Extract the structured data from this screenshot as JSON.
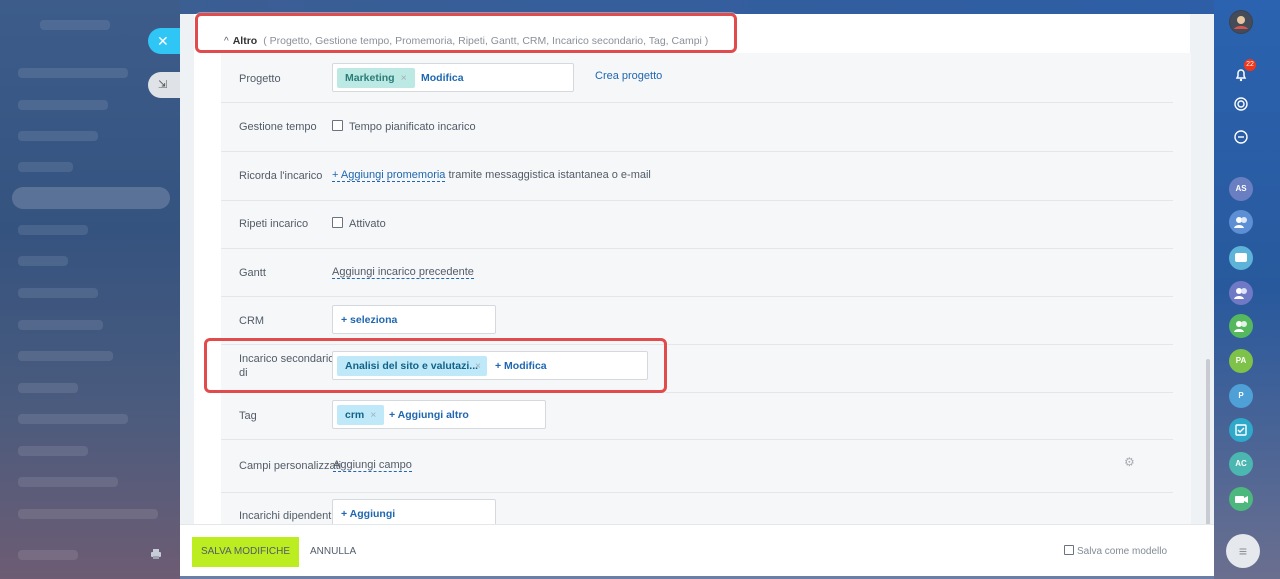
{
  "panel": {
    "close_icon": "✕",
    "collapse_icon": "⇲"
  },
  "altro": {
    "title": "Altro",
    "sections": "( Progetto,  Gestione tempo,  Promemoria,  Ripeti,  Gantt,  CRM,  Incarico secondario,  Tag,  Campi )"
  },
  "fields": {
    "progetto": {
      "label": "Progetto",
      "chip": "Marketing",
      "edit": "Modifica",
      "create": "Crea progetto"
    },
    "gestione_tempo": {
      "label": "Gestione tempo",
      "checkbox_label": "Tempo pianificato incarico"
    },
    "ricorda": {
      "label": "Ricorda l'incarico",
      "link": "+ Aggiungi promemoria",
      "suffix": " tramite messaggistica istantanea o e-mail"
    },
    "ripeti": {
      "label": "Ripeti incarico",
      "checkbox_label": "Attivato"
    },
    "gantt": {
      "label": "Gantt",
      "link": "Aggiungi incarico precedente"
    },
    "crm": {
      "label": "CRM",
      "select": "+  seleziona"
    },
    "incarico_secondario": {
      "label_line1": "Incarico secondario",
      "label_line2": "di",
      "chip": "Analisi del sito e valutazi...",
      "edit": "+ Modifica"
    },
    "tag": {
      "label": "Tag",
      "chip": "crm",
      "add": "+  Aggiungi altro"
    },
    "campi": {
      "label": "Campi personalizzati",
      "link": "Aggiungi campo"
    },
    "dipendenti": {
      "label": "Incarichi dipendenti",
      "add": "+  Aggiungi"
    }
  },
  "footer": {
    "save": "SALVA MODIFICHE",
    "cancel": "ANNULLA",
    "template": "Salva come modello"
  },
  "rail": {
    "bell_badge": "22",
    "avatars": [
      "AS",
      "PA",
      "P",
      "AC"
    ]
  },
  "colors": {
    "accent": "#2fc6f6",
    "save": "#bbed21",
    "highlight": "#e14b4b"
  }
}
